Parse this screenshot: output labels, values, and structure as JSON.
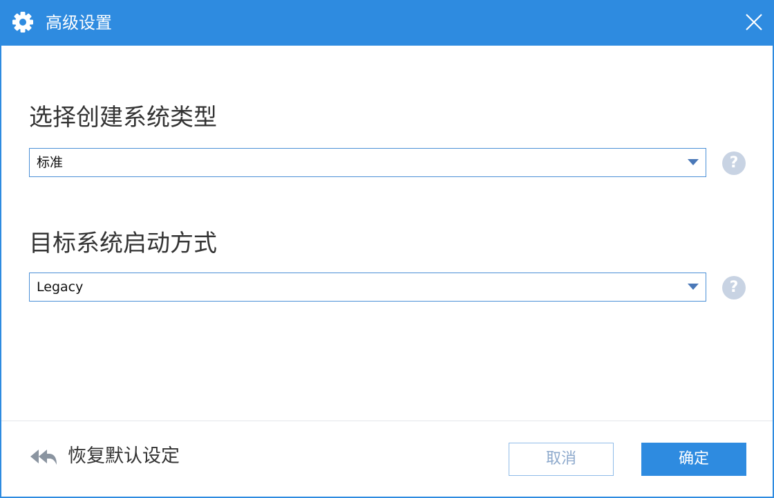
{
  "window": {
    "title": "高级设置",
    "title_icon": "gear-icon",
    "close_icon": "close-icon"
  },
  "sections": [
    {
      "label": "选择创建系统类型",
      "selected": "标准",
      "help_icon": "question-icon",
      "help_glyph": "?"
    },
    {
      "label": "目标系统启动方式",
      "selected": "Legacy",
      "help_icon": "question-icon",
      "help_glyph": "?"
    }
  ],
  "footer": {
    "restore_label": "恢复默认设定",
    "restore_icon": "reply-all-icon",
    "cancel_label": "取消",
    "ok_label": "确定"
  },
  "colors": {
    "accent": "#2e8be0",
    "select_border": "#4a8fd6",
    "help_icon": "#c8d3e3",
    "cancel_text": "#8da9cc"
  }
}
